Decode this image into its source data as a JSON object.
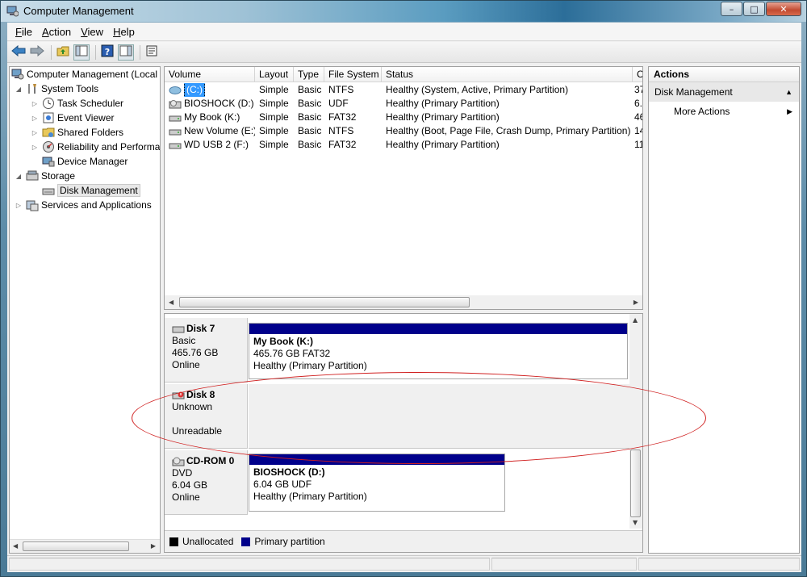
{
  "window": {
    "title": "Computer Management",
    "minimize_glyph": "–",
    "maximize_glyph": "□",
    "close_glyph": "✕"
  },
  "menu": [
    {
      "accel": "F",
      "rest": "ile"
    },
    {
      "accel": "A",
      "rest": "ction"
    },
    {
      "accel": "V",
      "rest": "iew"
    },
    {
      "accel": "H",
      "rest": "elp"
    }
  ],
  "toolbar": {
    "icons": [
      "back-arrow-icon",
      "forward-arrow-icon",
      "up-folder-icon",
      "show-hide-tree-icon",
      "help-icon",
      "action-pane-icon",
      "properties-icon"
    ]
  },
  "tree": {
    "items": [
      {
        "label": "Computer Management (Local",
        "icon": "computer-management-icon",
        "expander": ""
      },
      {
        "label": "System Tools",
        "icon": "system-tools-icon",
        "expander": "◢"
      },
      {
        "label": "Task Scheduler",
        "icon": "clock-icon",
        "expander": "▷"
      },
      {
        "label": "Event Viewer",
        "icon": "event-viewer-icon",
        "expander": "▷"
      },
      {
        "label": "Shared Folders",
        "icon": "shared-folder-icon",
        "expander": "▷"
      },
      {
        "label": "Reliability and Performa",
        "icon": "performance-icon",
        "expander": "▷"
      },
      {
        "label": "Device Manager",
        "icon": "device-manager-icon",
        "expander": ""
      },
      {
        "label": "Storage",
        "icon": "storage-icon",
        "expander": "◢"
      },
      {
        "label": "Disk Management",
        "icon": "disk-management-icon",
        "expander": ""
      },
      {
        "label": "Services and Applications",
        "icon": "services-icon",
        "expander": "▷"
      }
    ]
  },
  "volumes": {
    "columns": [
      "Volume",
      "Layout",
      "Type",
      "File System",
      "Status",
      "C"
    ],
    "rows": [
      {
        "volume": "(C:)",
        "layout": "Simple",
        "type": "Basic",
        "fs": "NTFS",
        "status": "Healthy (System, Active, Primary Partition)",
        "cap": "37",
        "icon": "volume-c-icon"
      },
      {
        "volume": "BIOSHOCK (D:)",
        "layout": "Simple",
        "type": "Basic",
        "fs": "UDF",
        "status": "Healthy (Primary Partition)",
        "cap": "6.",
        "icon": "cd-drive-icon"
      },
      {
        "volume": "My Book (K:)",
        "layout": "Simple",
        "type": "Basic",
        "fs": "FAT32",
        "status": "Healthy (Primary Partition)",
        "cap": "46",
        "icon": "drive-icon"
      },
      {
        "volume": "New Volume (E:)",
        "layout": "Simple",
        "type": "Basic",
        "fs": "NTFS",
        "status": "Healthy (Boot, Page File, Crash Dump, Primary Partition)",
        "cap": "14",
        "icon": "drive-icon"
      },
      {
        "volume": "WD USB 2 (F:)",
        "layout": "Simple",
        "type": "Basic",
        "fs": "FAT32",
        "status": "Healthy (Primary Partition)",
        "cap": "11",
        "icon": "drive-icon"
      }
    ]
  },
  "disks": [
    {
      "name": "Disk 7",
      "lines": [
        "Basic",
        "465.76 GB",
        "Online"
      ],
      "icon": "disk-icon",
      "partition": {
        "name": "My Book  (K:)",
        "size": "465.76 GB FAT32",
        "status": "Healthy (Primary Partition)"
      }
    },
    {
      "name": "Disk 8",
      "lines": [
        "Unknown",
        "",
        "Unreadable"
      ],
      "icon": "disk-error-icon"
    },
    {
      "name": "CD-ROM 0",
      "lines": [
        "DVD",
        "6.04 GB",
        "Online"
      ],
      "icon": "cdrom-icon",
      "partition": {
        "name": "BIOSHOCK  (D:)",
        "size": "6.04 GB UDF",
        "status": "Healthy (Primary Partition)"
      }
    }
  ],
  "legend": [
    {
      "label": "Unallocated",
      "color": "#000000"
    },
    {
      "label": "Primary partition",
      "color": "#00008b"
    }
  ],
  "actions": {
    "header": "Actions",
    "section": "Disk Management",
    "items": [
      "More Actions"
    ]
  },
  "colors": {
    "primary_partition": "#00008b",
    "selection": "#3399ff",
    "annotation": "#d02020"
  }
}
